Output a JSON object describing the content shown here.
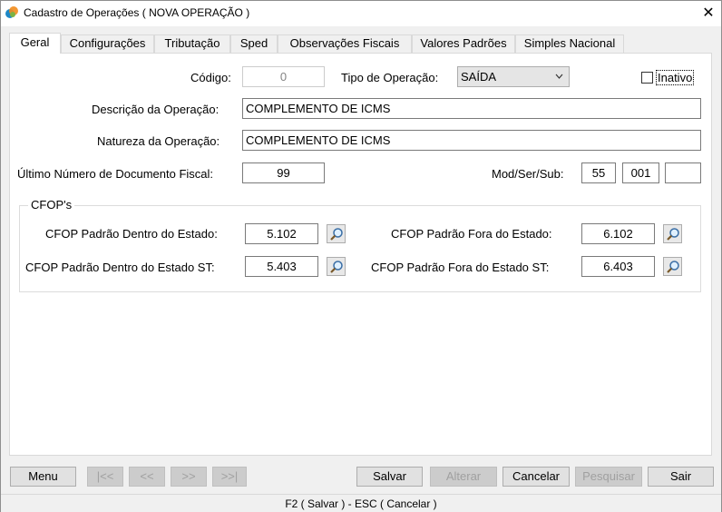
{
  "window": {
    "title": "Cadastro de Operações ( NOVA OPERAÇÃO )",
    "close_symbol": "✕"
  },
  "tabs": [
    {
      "label": "Geral"
    },
    {
      "label": "Configurações"
    },
    {
      "label": "Tributação"
    },
    {
      "label": "Sped"
    },
    {
      "label": "Observações Fiscais"
    },
    {
      "label": "Valores Padrões"
    },
    {
      "label": "Simples Nacional"
    }
  ],
  "form": {
    "codigo_label": "Código:",
    "codigo_value": "0",
    "tipo_label": "Tipo de Operação:",
    "tipo_value": "SAÍDA",
    "inativo_label": "Inativo",
    "descricao_label": "Descrição da Operação:",
    "descricao_value": "COMPLEMENTO DE ICMS",
    "natureza_label": "Natureza da Operação:",
    "natureza_value": "COMPLEMENTO DE ICMS",
    "ultimo_label": "Último Número de Documento Fiscal:",
    "ultimo_value": "99",
    "modsersub_label": "Mod/Ser/Sub:",
    "mod_value": "55",
    "ser_value": "001",
    "sub_value": ""
  },
  "cfop": {
    "group_title": "CFOP's",
    "dentro_label": "CFOP Padrão Dentro do Estado:",
    "dentro_value": "5.102",
    "fora_label": "CFOP Padrão Fora do Estado:",
    "fora_value": "6.102",
    "dentro_st_label": "CFOP Padrão Dentro do Estado ST:",
    "dentro_st_value": "5.403",
    "fora_st_label": "CFOP Padrão Fora do Estado ST:",
    "fora_st_value": "6.403"
  },
  "buttons": {
    "menu": "Menu",
    "first": "|<<",
    "prev": "<<",
    "next": ">>",
    "last": ">>|",
    "salvar": "Salvar",
    "alterar": "Alterar",
    "cancelar": "Cancelar",
    "pesquisar": "Pesquisar",
    "sair": "Sair"
  },
  "status": {
    "text": "F2 ( Salvar )  -  ESC ( Cancelar )"
  }
}
